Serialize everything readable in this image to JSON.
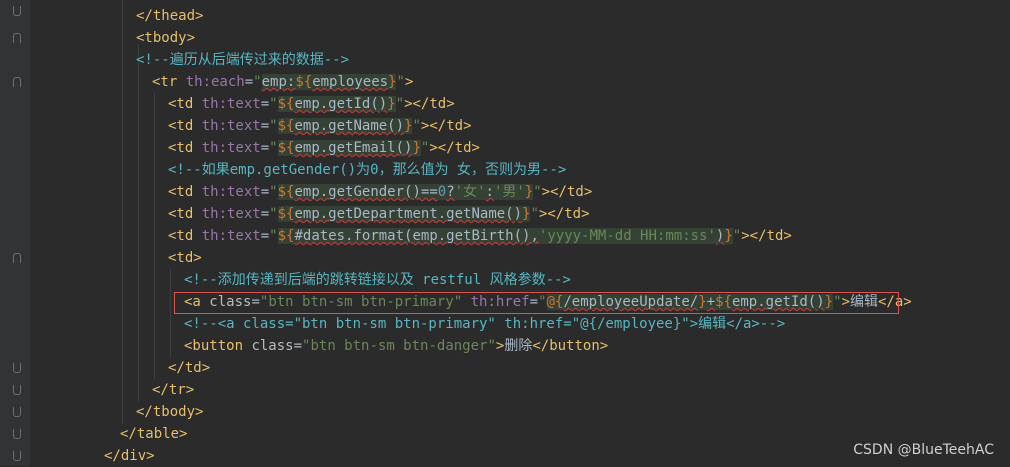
{
  "editor": {
    "lines": [
      {
        "indent": 8,
        "parts": [
          [
            "tag",
            "</thead>"
          ]
        ]
      },
      {
        "indent": 8,
        "parts": [
          [
            "tag",
            "<tbody>"
          ]
        ]
      },
      {
        "indent": 8,
        "parts": [
          [
            "cmt2",
            "<!--遍历从后端传过来的数据-->"
          ]
        ]
      },
      {
        "indent": 12,
        "parts": [
          [
            "tag",
            "<tr "
          ],
          [
            "attrns",
            "th:each"
          ],
          [
            "txt",
            "="
          ],
          [
            "str",
            "\""
          ],
          [
            "expr",
            "emp:${employees}"
          ],
          [
            "str",
            "\""
          ],
          [
            "tag",
            ">"
          ]
        ]
      },
      {
        "indent": 16,
        "parts": [
          [
            "tag",
            "<td "
          ],
          [
            "attrns",
            "th:text"
          ],
          [
            "txt",
            "="
          ],
          [
            "str",
            "\""
          ],
          [
            "expr",
            "${emp.getId()}"
          ],
          [
            "str",
            "\""
          ],
          [
            "tag",
            "></td>"
          ]
        ]
      },
      {
        "indent": 16,
        "parts": [
          [
            "tag",
            "<td "
          ],
          [
            "attrns",
            "th:text"
          ],
          [
            "txt",
            "="
          ],
          [
            "str",
            "\""
          ],
          [
            "expr",
            "${emp.getName()}"
          ],
          [
            "str",
            "\""
          ],
          [
            "tag",
            "></td>"
          ]
        ]
      },
      {
        "indent": 16,
        "parts": [
          [
            "tag",
            "<td "
          ],
          [
            "attrns",
            "th:text"
          ],
          [
            "txt",
            "="
          ],
          [
            "str",
            "\""
          ],
          [
            "expr",
            "${emp.getEmail()}"
          ],
          [
            "str",
            "\""
          ],
          [
            "tag",
            "></td>"
          ]
        ]
      },
      {
        "indent": 16,
        "parts": [
          [
            "cmt2",
            "<!--如果emp.getGender()为0，那么值为 女，否则为男-->"
          ]
        ]
      },
      {
        "indent": 16,
        "parts": [
          [
            "tag",
            "<td "
          ],
          [
            "attrns",
            "th:text"
          ],
          [
            "txt",
            "="
          ],
          [
            "str",
            "\""
          ],
          [
            "expr",
            "${emp.getGender()==0?'女':'男'}"
          ],
          [
            "str",
            "\""
          ],
          [
            "tag",
            "></td>"
          ]
        ]
      },
      {
        "indent": 16,
        "parts": [
          [
            "tag",
            "<td "
          ],
          [
            "attrns",
            "th:text"
          ],
          [
            "txt",
            "="
          ],
          [
            "str",
            "\""
          ],
          [
            "expr",
            "${emp.getDepartment.getName()}"
          ],
          [
            "str",
            "\""
          ],
          [
            "tag",
            "></td>"
          ]
        ]
      },
      {
        "indent": 16,
        "parts": [
          [
            "tag",
            "<td "
          ],
          [
            "attrns",
            "th:text"
          ],
          [
            "txt",
            "="
          ],
          [
            "str",
            "\""
          ],
          [
            "expr",
            "${#dates.format(emp.getBirth(),'yyyy-MM-dd HH:mm:ss')}"
          ],
          [
            "str",
            "\""
          ],
          [
            "tag",
            "></td>"
          ]
        ]
      },
      {
        "indent": 16,
        "parts": [
          [
            "tag",
            "<td>"
          ]
        ]
      },
      {
        "indent": 20,
        "parts": [
          [
            "cmt2",
            "<!--添加传递到后端的跳转链接以及 restful 风格参数-->"
          ]
        ]
      },
      {
        "indent": 20,
        "parts": [
          [
            "tag",
            "<a "
          ],
          [
            "attr",
            "class"
          ],
          [
            "txt",
            "="
          ],
          [
            "str",
            "\"btn btn-sm btn-primary\" "
          ],
          [
            "attrns",
            "th:href"
          ],
          [
            "txt",
            "="
          ],
          [
            "str",
            "\""
          ],
          [
            "expr",
            "@{/employeeUpdate/}+${emp.getId()}"
          ],
          [
            "str",
            "\""
          ],
          [
            "tag",
            ">"
          ],
          [
            "txt",
            "编辑"
          ],
          [
            "tag",
            "</a>"
          ]
        ]
      },
      {
        "indent": 20,
        "parts": [
          [
            "cmt2",
            "<!--<a class=\"btn btn-sm btn-primary\" th:href=\"@{/employee}\">编辑</a>-->"
          ]
        ]
      },
      {
        "indent": 20,
        "parts": [
          [
            "tag",
            "<button "
          ],
          [
            "attr",
            "class"
          ],
          [
            "txt",
            "="
          ],
          [
            "str",
            "\"btn btn-sm btn-danger\""
          ],
          [
            "tag",
            ">"
          ],
          [
            "txt",
            "删除"
          ],
          [
            "tag",
            "</button>"
          ]
        ]
      },
      {
        "indent": 16,
        "parts": [
          [
            "tag",
            "</td>"
          ]
        ]
      },
      {
        "indent": 12,
        "parts": [
          [
            "tag",
            "</tr>"
          ]
        ]
      },
      {
        "indent": 8,
        "parts": [
          [
            "tag",
            "</tbody>"
          ]
        ]
      },
      {
        "indent": 4,
        "parts": [
          [
            "tag",
            "</table>"
          ]
        ]
      },
      {
        "indent": 0,
        "parts": [
          [
            "tag",
            "</div>"
          ]
        ]
      }
    ]
  },
  "watermark": "CSDN @BlueTeehAC"
}
